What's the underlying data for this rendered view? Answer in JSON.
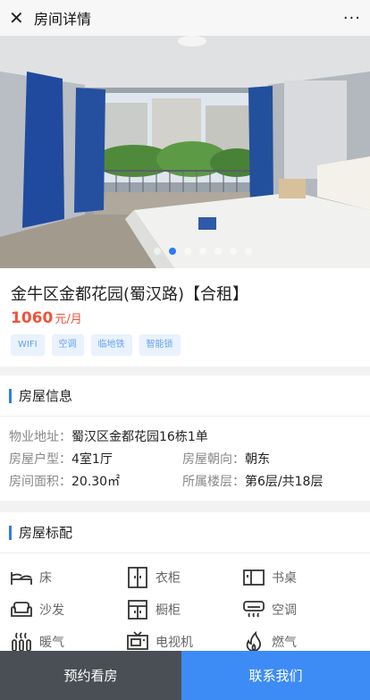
{
  "titlebar": {
    "close_icon": "close-icon",
    "title": "房间详情",
    "more_icon": "more-dots-icon",
    "more_label": "···"
  },
  "gallery": {
    "image": "bedroom-photo",
    "dot_count": 7,
    "active_index": 1
  },
  "house": {
    "name": "金牛区金都花园(蜀汉路)【合租】",
    "price": "1060",
    "price_unit": "元/月",
    "tags": [
      "WIFI",
      "空调",
      "临地铁",
      "智能锁"
    ]
  },
  "info": {
    "section_title": "房屋信息",
    "address_label": "物业地址：",
    "address": "蜀汉区金都花园16栋1单",
    "layout_label": "房屋户型：",
    "layout": "4室1厅",
    "orientation_label": "房屋朝向：",
    "orientation": "朝东",
    "area_label": "房间面积：",
    "area": "20.30㎡",
    "floor_label": "所属楼层：",
    "floor": "第6层/共18层"
  },
  "equipment": {
    "section_title": "房屋标配",
    "items": [
      {
        "label": "床",
        "icon": "bed-icon"
      },
      {
        "label": "衣柜",
        "icon": "wardrobe-icon"
      },
      {
        "label": "书桌",
        "icon": "desk-icon"
      },
      {
        "label": "沙发",
        "icon": "sofa-icon"
      },
      {
        "label": "橱柜",
        "icon": "cabinet-icon"
      },
      {
        "label": "空调",
        "icon": "air-conditioner-icon"
      },
      {
        "label": "暖气",
        "icon": "heater-icon"
      },
      {
        "label": "电视机",
        "icon": "tv-icon"
      },
      {
        "label": "燃气",
        "icon": "gas-flame-icon"
      }
    ]
  },
  "actions": {
    "book_label": "预约看房",
    "contact_label": "联系我们"
  },
  "colors": {
    "accent": "#2f7bf5",
    "price": "#f0523a",
    "contact_button": "#3d8cf5",
    "book_button": "#4a4f55"
  }
}
